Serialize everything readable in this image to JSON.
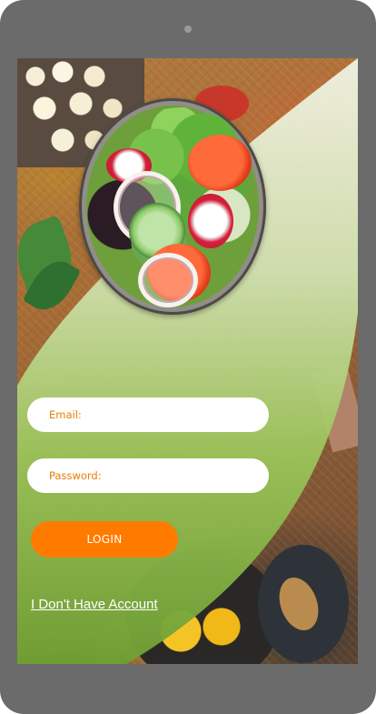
{
  "colors": {
    "accent": "#ff7b00",
    "placeholder": "#e67e00",
    "panel_top": "#f2f8ea",
    "panel_bottom": "#6f9f33",
    "device_frame": "#6b6b6b"
  },
  "background": {
    "image": "salad-bowl-photo",
    "icons": [
      "salad-bowl-image",
      "cheese-bowl-image",
      "pan-image"
    ]
  },
  "login_form": {
    "email_placeholder": "Email:",
    "password_placeholder": "Password:",
    "login_label": "LOGIN",
    "no_account_link": "I Don't Have Account"
  }
}
